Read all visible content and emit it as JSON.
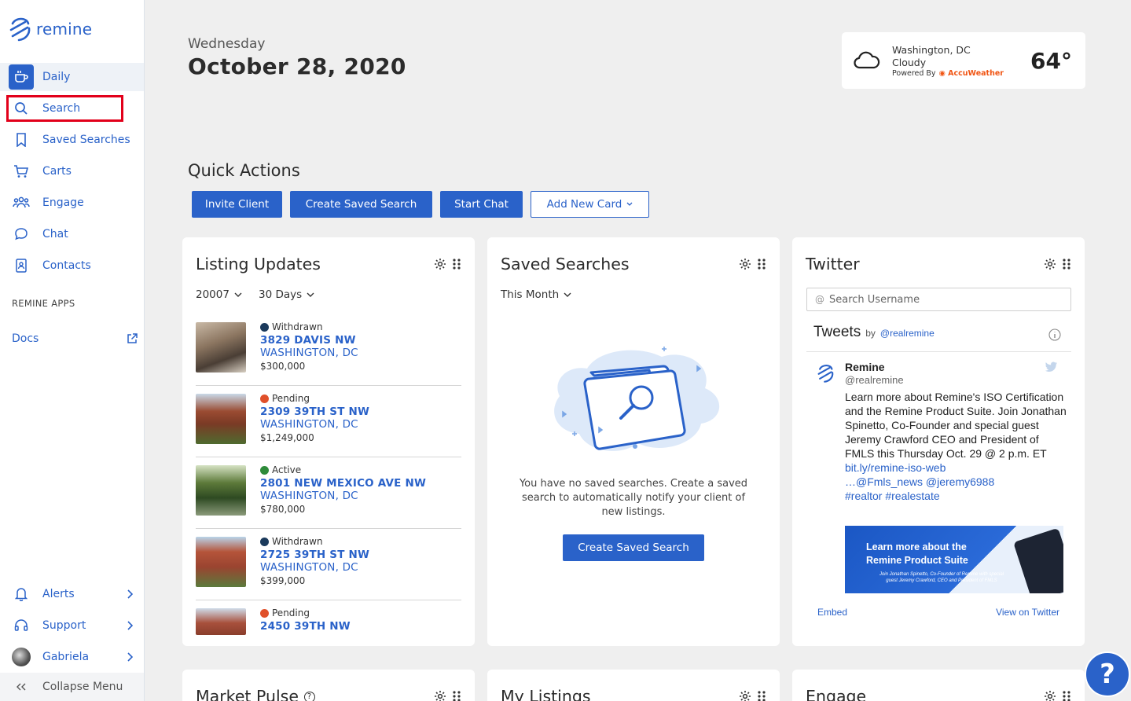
{
  "app": {
    "name": "remine"
  },
  "sidebar": {
    "nav": [
      {
        "label": "Daily",
        "icon": "coffee-cup-icon"
      },
      {
        "label": "Search",
        "icon": "search-icon"
      },
      {
        "label": "Saved Searches",
        "icon": "bookmark-icon"
      },
      {
        "label": "Carts",
        "icon": "cart-icon"
      },
      {
        "label": "Engage",
        "icon": "people-icon"
      },
      {
        "label": "Chat",
        "icon": "chat-icon"
      },
      {
        "label": "Contacts",
        "icon": "contacts-icon"
      }
    ],
    "section_label": "REMINE APPS",
    "docs_label": "Docs",
    "bottom": [
      {
        "label": "Alerts",
        "icon": "bell-icon"
      },
      {
        "label": "Support",
        "icon": "headset-icon"
      },
      {
        "label": "Gabriela",
        "icon": "avatar"
      }
    ],
    "collapse_label": "Collapse Menu"
  },
  "header": {
    "day": "Wednesday",
    "date": "October 28, 2020"
  },
  "weather": {
    "city": "Washington, DC",
    "condition": "Cloudy",
    "powered_by": "Powered By",
    "provider": "AccuWeather",
    "temp": "64°"
  },
  "quick_actions": {
    "title": "Quick Actions",
    "buttons": [
      "Invite Client",
      "Create Saved Search",
      "Start Chat",
      "Add New Card"
    ]
  },
  "listing_updates": {
    "title": "Listing Updates",
    "filter_zip": "20007",
    "filter_period": "30 Days",
    "items": [
      {
        "status": "Withdrawn",
        "status_color": "#1b3a5c",
        "address": "3829 DAVIS NW",
        "city": "WASHINGTON, DC",
        "price": "$300,000"
      },
      {
        "status": "Pending",
        "status_color": "#e0502a",
        "address": "2309 39TH ST NW",
        "city": "WASHINGTON, DC",
        "price": "$1,249,000"
      },
      {
        "status": "Active",
        "status_color": "#2e8b3a",
        "address": "2801 NEW MEXICO AVE NW",
        "city": "WASHINGTON, DC",
        "price": "$780,000"
      },
      {
        "status": "Withdrawn",
        "status_color": "#1b3a5c",
        "address": "2725 39TH ST NW",
        "city": "WASHINGTON, DC",
        "price": "$399,000"
      },
      {
        "status": "Pending",
        "status_color": "#e0502a",
        "address": "2450 39TH NW",
        "city": "",
        "price": ""
      }
    ]
  },
  "saved_searches": {
    "title": "Saved Searches",
    "filter": "This Month",
    "empty_text": "You have no saved searches. Create a saved search to automatically notify your client of new listings.",
    "button": "Create Saved Search"
  },
  "twitter": {
    "title": "Twitter",
    "search_placeholder": "Search Username",
    "tweets_label": "Tweets",
    "by_label": "by",
    "handle_link": "@realremine",
    "tweet": {
      "name": "Remine",
      "handle": "@realremine",
      "text": "Learn more about Remine's ISO Certification and the Remine Product Suite. Join Jonathan Spinetto, Co-Founder and special guest Jeremy Crawford CEO and President of FMLS this Thursday Oct. 29 @ 2 p.m. ET",
      "link1": "bit.ly/remine-iso-web",
      "link2": "…@Fmls_news @jeremy6988",
      "link3": "#realtor #realestate",
      "image_title": "Learn more about the Remine Product Suite",
      "image_sub": "Join Jonathan Spinetto, Co-Founder of Remine with special guest Jeremy Crawford, CEO and President of FMLS"
    },
    "embed": "Embed",
    "view": "View on Twitter"
  },
  "bottom_cards": [
    "Market Pulse",
    "My Listings",
    "Engage"
  ],
  "colors": {
    "accent": "#2a62c9",
    "highlight": "#e2001a"
  }
}
